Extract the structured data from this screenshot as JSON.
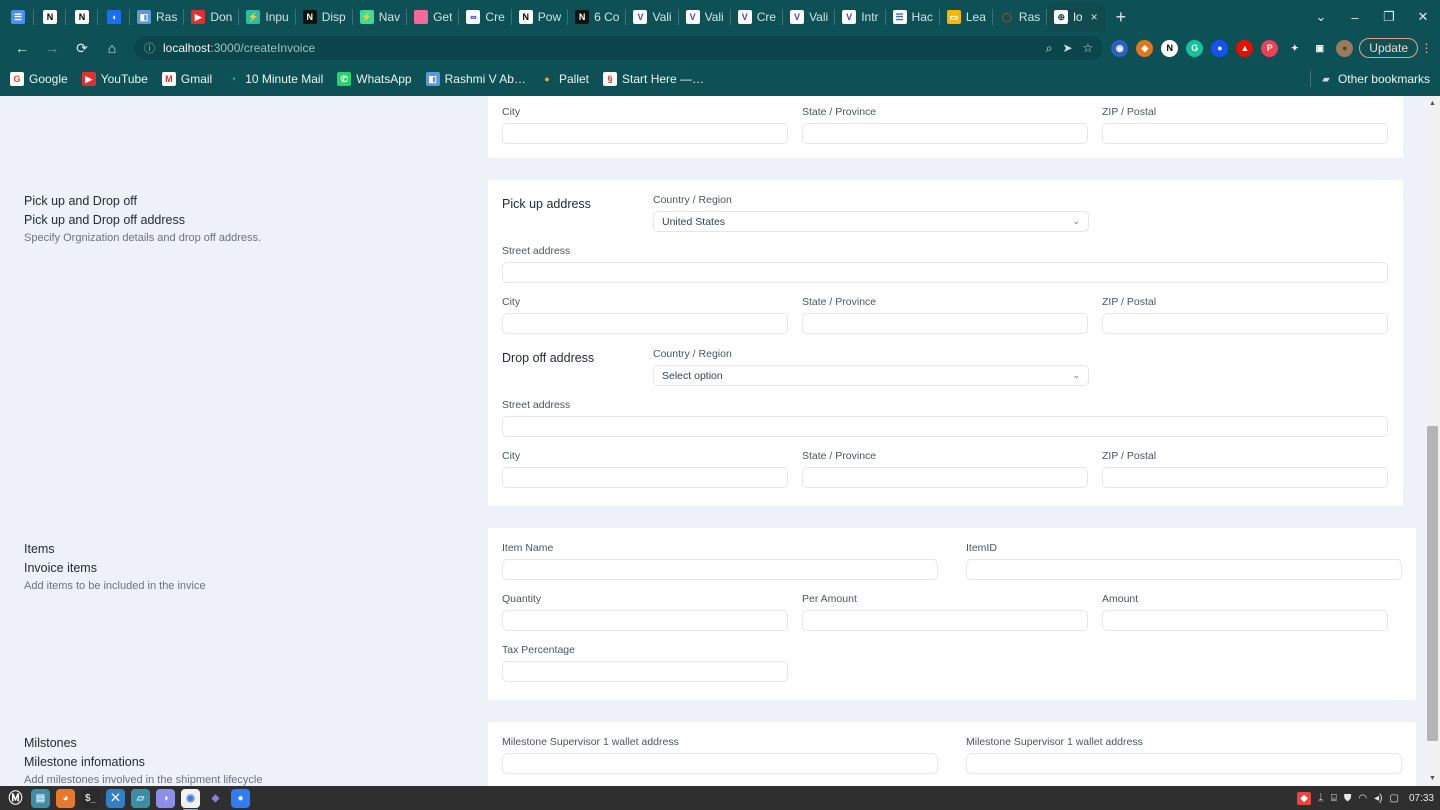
{
  "browser": {
    "tabs": [
      {
        "label": "",
        "icon": "doc-blue-icon",
        "fg": "#ffffff",
        "bg": "#4c8ef7",
        "glyph": "☰",
        "narrow": true
      },
      {
        "label": "",
        "icon": "notion-icon",
        "fg": "#000000",
        "bg": "#ffffff",
        "glyph": "N",
        "narrow": true
      },
      {
        "label": "",
        "icon": "notion-icon",
        "fg": "#000000",
        "bg": "#ffffff",
        "glyph": "N",
        "narrow": true
      },
      {
        "label": "",
        "icon": "blue-drop-icon",
        "fg": "#ffffff",
        "bg": "#1d6cf5",
        "glyph": "◖",
        "narrow": true
      },
      {
        "label": "Ras",
        "icon": "slides-icon",
        "fg": "#ffffff",
        "bg": "#5b9bd5",
        "glyph": "◧"
      },
      {
        "label": "Don",
        "icon": "youtube-icon",
        "fg": "#ffffff",
        "bg": "#e23030",
        "glyph": "▶"
      },
      {
        "label": "Inpu",
        "icon": "bolt-teal-icon",
        "fg": "#ffffff",
        "bg": "#2bbfa0",
        "glyph": "⚡"
      },
      {
        "label": "Disp",
        "icon": "notion-dark-icon",
        "fg": "#ffffff",
        "bg": "#111111",
        "glyph": "N"
      },
      {
        "label": "Nav",
        "icon": "bolt-green-icon",
        "fg": "#ffffff",
        "bg": "#3ddc97",
        "glyph": "⚡"
      },
      {
        "label": "Get",
        "icon": "pink-square-icon",
        "fg": "#ffffff",
        "bg": "#f3689a",
        "glyph": ""
      },
      {
        "label": "Cre",
        "icon": "infinity-icon",
        "fg": "#1a1aff",
        "bg": "#ffffff",
        "glyph": "∞"
      },
      {
        "label": "Pow",
        "icon": "notion-icon",
        "fg": "#000000",
        "bg": "#ffffff",
        "glyph": "N"
      },
      {
        "label": "6 Co",
        "icon": "notion-dark-icon",
        "fg": "#ffffff",
        "bg": "#111111",
        "glyph": "N"
      },
      {
        "label": "Vali",
        "icon": "vercel-v-icon",
        "fg": "#4b3fd4",
        "bg": "#ffffff",
        "glyph": "V"
      },
      {
        "label": "Vali",
        "icon": "vercel-v-icon",
        "fg": "#4b3fd4",
        "bg": "#ffffff",
        "glyph": "V"
      },
      {
        "label": "Cre",
        "icon": "vercel-v-icon",
        "fg": "#4b3fd4",
        "bg": "#ffffff",
        "glyph": "V"
      },
      {
        "label": "Vali",
        "icon": "vercel-v-icon",
        "fg": "#4b3fd4",
        "bg": "#ffffff",
        "glyph": "V"
      },
      {
        "label": "Intr",
        "icon": "vercel-v-icon",
        "fg": "#4b3fd4",
        "bg": "#ffffff",
        "glyph": "V"
      },
      {
        "label": "Hac",
        "icon": "document-icon",
        "fg": "#3b6ea5",
        "bg": "#ffffff",
        "glyph": "☰"
      },
      {
        "label": "Lea",
        "icon": "yellow-window-icon",
        "fg": "#ffffff",
        "bg": "#f5b700",
        "glyph": "▭"
      },
      {
        "label": "Ras",
        "icon": "red-circle-icon",
        "fg": "#c0392b",
        "bg": "#0d5157",
        "glyph": "◯"
      }
    ],
    "active_tab": {
      "label": "lo",
      "icon": "globe-icon",
      "glyph": "⊕",
      "close": "×"
    },
    "new_tab_label": "+",
    "tab_list_chevron": "⌄",
    "window_controls": {
      "minimize": "–",
      "maximize": "❐",
      "close": "✕"
    },
    "nav": {
      "back": "←",
      "forward": "→",
      "reload": "⟳",
      "home": "⌂"
    },
    "omnibox": {
      "info_icon": "ⓘ",
      "url_host": "localhost",
      "url_path": ":3000/createInvoice",
      "zoom_icon": "⌕",
      "share_icon": "➤",
      "bookmark_icon": "☆"
    },
    "extensions": [
      {
        "name": "blue-aperture-icon",
        "bg": "#2f5fbf",
        "glyph": "◉",
        "fg": "#ffffff"
      },
      {
        "name": "metamask-icon",
        "bg": "#e2761b",
        "glyph": "◆",
        "fg": "#ffffff"
      },
      {
        "name": "notion-web-clipper-icon",
        "bg": "#ffffff",
        "glyph": "N",
        "fg": "#000000"
      },
      {
        "name": "grammarly-icon",
        "bg": "#15c39a",
        "glyph": "G",
        "fg": "#ffffff"
      },
      {
        "name": "coinbase-wallet-icon",
        "bg": "#1652f0",
        "glyph": "●",
        "fg": "#ffffff"
      },
      {
        "name": "brave-shield-icon",
        "bg": "#eb0f00",
        "glyph": "▲",
        "fg": "#ffffff"
      },
      {
        "name": "pocket-icon",
        "bg": "#ef4056",
        "glyph": "P",
        "fg": "#ffffff"
      },
      {
        "name": "extensions-puzzle-icon",
        "bg": "#0d5157",
        "glyph": "✦",
        "fg": "#ffffff"
      },
      {
        "name": "side-panel-icon",
        "bg": "#0d5157",
        "glyph": "▣",
        "fg": "#ffffff"
      },
      {
        "name": "profile-avatar",
        "bg": "#9b7b5e",
        "glyph": "●",
        "fg": "#5b4030"
      }
    ],
    "update_label": "Update",
    "menu_icon": "⋮",
    "bookmarks": [
      {
        "label": "Google",
        "icon": "google-icon",
        "bg": "#ffffff",
        "fg": "#ea4335",
        "glyph": "G"
      },
      {
        "label": "YouTube",
        "icon": "youtube-icon",
        "bg": "#e23030",
        "fg": "#ffffff",
        "glyph": "▶"
      },
      {
        "label": "Gmail",
        "icon": "gmail-icon",
        "bg": "#ffffff",
        "fg": "#d93025",
        "glyph": "M"
      },
      {
        "label": "10 Minute Mail",
        "icon": "ten-minute-mail-icon",
        "bg": "#0d5157",
        "fg": "#3ddc97",
        "glyph": "◔"
      },
      {
        "label": "WhatsApp",
        "icon": "whatsapp-icon",
        "bg": "#25d366",
        "fg": "#ffffff",
        "glyph": "✆"
      },
      {
        "label": "Rashmi V Ab…",
        "icon": "slides-icon",
        "bg": "#5b9bd5",
        "fg": "#ffffff",
        "glyph": "◧"
      },
      {
        "label": "Pallet",
        "icon": "pallet-icon",
        "bg": "#0d5157",
        "fg": "#f0a33c",
        "glyph": "●"
      },
      {
        "label": "Start Here —…",
        "icon": "start-here-icon",
        "bg": "#ffffff",
        "fg": "#c0392b",
        "glyph": "§"
      }
    ],
    "other_bookmarks": {
      "label": "Other bookmarks",
      "icon": "folder-icon",
      "glyph": "▰"
    }
  },
  "page": {
    "sections": [
      {
        "id": "organization",
        "title": "",
        "subtitle": "",
        "description": "",
        "fields": [
          {
            "label": "City"
          },
          {
            "label": "State / Province"
          },
          {
            "label": "ZIP / Postal"
          }
        ]
      },
      {
        "id": "pickup-dropoff",
        "title": "Pick up and Drop off",
        "subtitle": "Pick up and Drop off address",
        "description": "Specify Orgnization details and drop off address.",
        "pickup": {
          "heading": "Pick up address",
          "country_label": "Country / Region",
          "country_value": "United States",
          "street_label": "Street address",
          "city_label": "City",
          "state_label": "State / Province",
          "zip_label": "ZIP / Postal"
        },
        "dropoff": {
          "heading": "Drop off address",
          "country_label": "Country / Region",
          "country_value": "Select option",
          "street_label": "Street address",
          "city_label": "City",
          "state_label": "State / Province",
          "zip_label": "ZIP / Postal"
        }
      },
      {
        "id": "items",
        "title": "Items",
        "subtitle": "Invoice items",
        "description": "Add items to be included in the invice",
        "fields": {
          "item_name": "Item Name",
          "item_id": "ItemID",
          "quantity": "Quantity",
          "per_amount": "Per Amount",
          "amount": "Amount",
          "tax_percentage": "Tax Percentage"
        }
      },
      {
        "id": "milestones",
        "title": "Milstones",
        "subtitle": "Milestone infomations",
        "description": "Add milestones involved in the shipment lifecycle",
        "fields": {
          "supervisor_1": "Milestone Supervisor 1 wallet address",
          "supervisor_2": "Milestone Supervisor 1 wallet address"
        }
      }
    ],
    "select_chevron": "⌄",
    "scrollbar": {
      "up_arrow": "▲",
      "down_arrow": "▼"
    }
  },
  "taskbar": {
    "menu_icon": "Ⓜ",
    "apps": [
      {
        "name": "files-manager-icon",
        "bg": "#3b8ea8",
        "glyph": "▤",
        "fg": "#cfe9f2"
      },
      {
        "name": "firefox-icon",
        "bg": "#e8792b",
        "glyph": "◕",
        "fg": "#ffffff"
      },
      {
        "name": "terminal-icon",
        "bg": "#2b2b2b",
        "glyph": "$_",
        "fg": "#dddddd"
      },
      {
        "name": "vscode-icon",
        "bg": "#2f80c7",
        "glyph": "⨉",
        "fg": "#ffffff"
      },
      {
        "name": "file-explorer-icon",
        "bg": "#3b8ea8",
        "glyph": "▱",
        "fg": "#d7eef6"
      },
      {
        "name": "discord-icon",
        "bg": "#8b8fe8",
        "glyph": "◑",
        "fg": "#ffffff"
      },
      {
        "name": "chrome-icon",
        "bg": "#f2f2f2",
        "glyph": "◉",
        "fg": "#3b78e7"
      },
      {
        "name": "ethereum-icon",
        "bg": "#2f2f2f",
        "glyph": "◆",
        "fg": "#8a7ce0"
      },
      {
        "name": "location-app-icon",
        "bg": "#2f7df6",
        "glyph": "●",
        "fg": "#ffffff"
      }
    ],
    "tray": [
      {
        "name": "redshift-icon",
        "glyph": "◆",
        "bg": "#e8453c",
        "fg": "#ffffff"
      },
      {
        "name": "bluetooth-icon",
        "glyph": "ᛦ",
        "bg": "",
        "fg": "#e8e8e8"
      },
      {
        "name": "clipboard-icon",
        "glyph": "⌸",
        "bg": "",
        "fg": "#e8e8e8"
      },
      {
        "name": "update-shield-icon",
        "glyph": "⛊",
        "bg": "",
        "fg": "#e8e8e8"
      },
      {
        "name": "wifi-icon",
        "glyph": "◠",
        "bg": "",
        "fg": "#e8e8e8"
      },
      {
        "name": "volume-icon",
        "glyph": "◂)",
        "bg": "",
        "fg": "#e8e8e8"
      },
      {
        "name": "battery-icon",
        "glyph": "▢",
        "bg": "",
        "fg": "#e8e8e8"
      }
    ],
    "clock": "07:33"
  }
}
